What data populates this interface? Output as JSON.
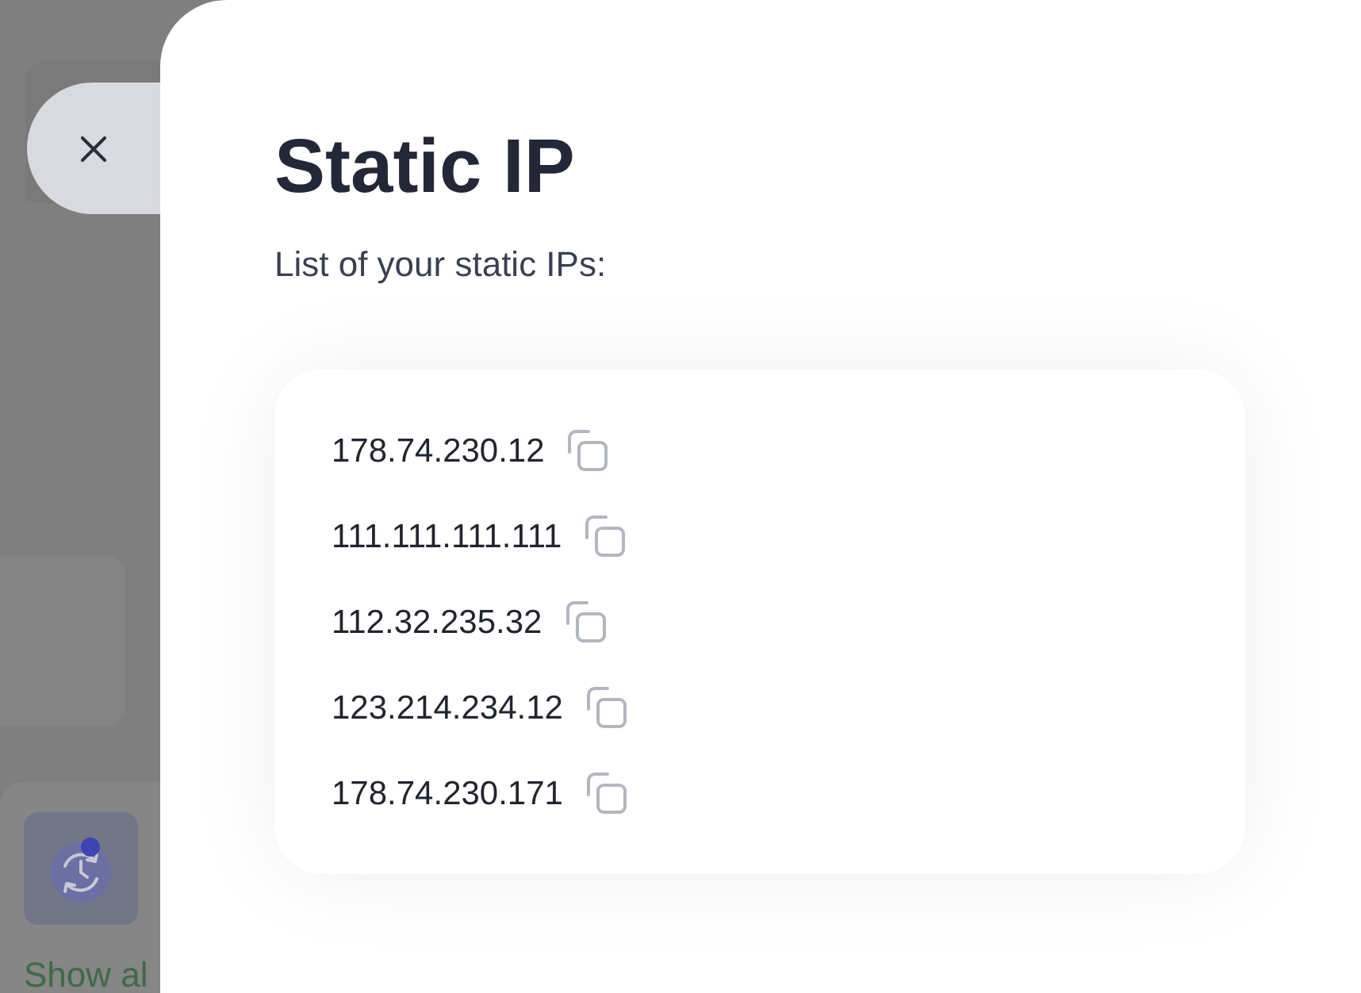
{
  "background_page": {
    "link": "Show al"
  },
  "modal": {
    "title": "Static IP",
    "subtitle": "List of your static IPs:",
    "static_ips": [
      "178.74.230.12",
      "111.111.111.111",
      "112.32.235.32",
      "123.214.234.12",
      "178.74.230.171"
    ]
  }
}
